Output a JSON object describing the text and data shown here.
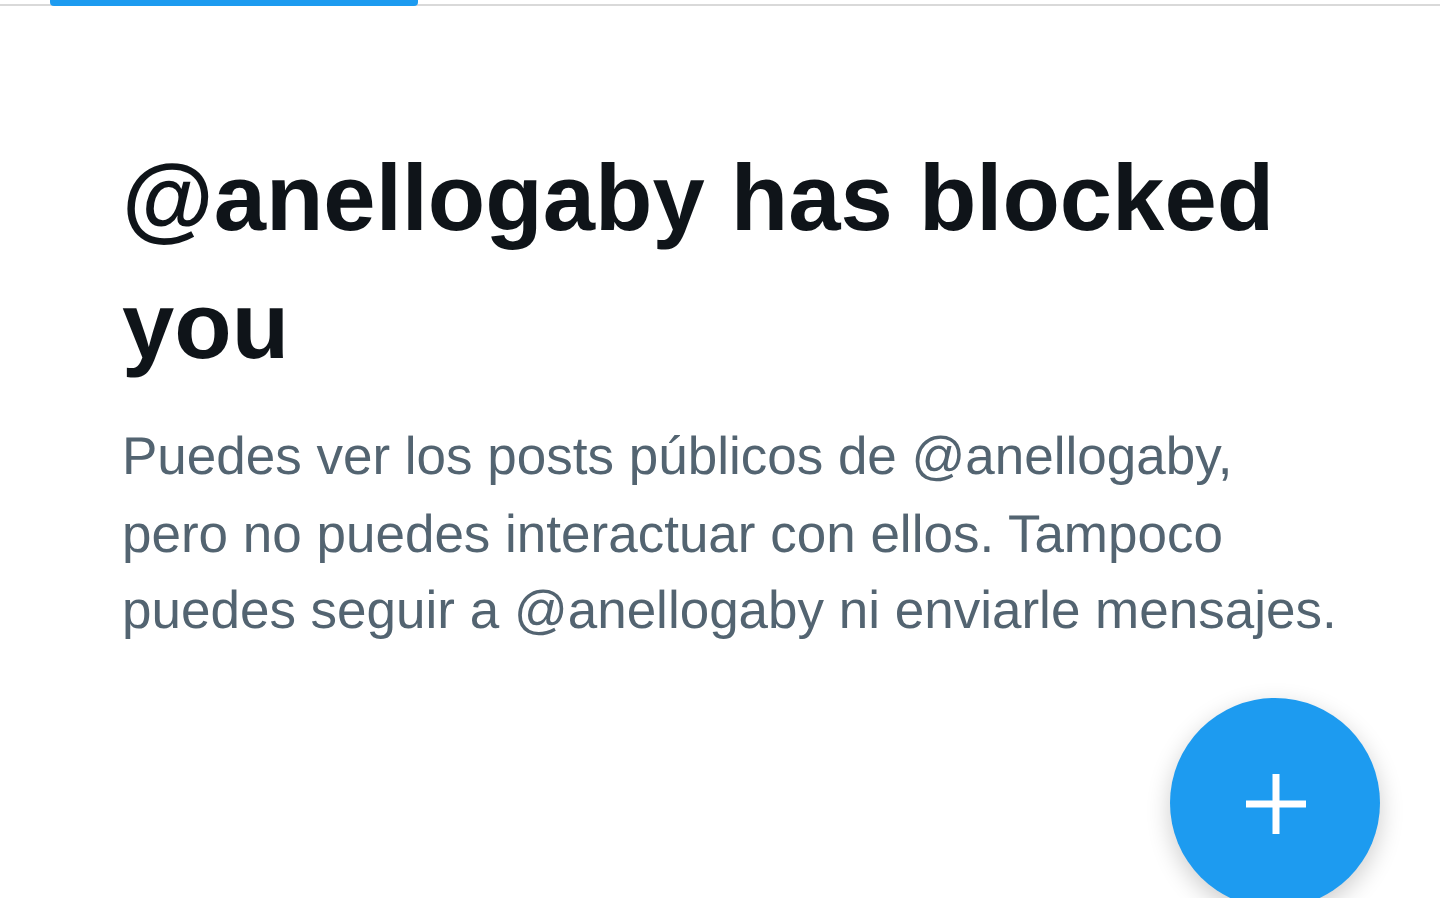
{
  "title": "@anellogaby has blocked you",
  "message": "Puedes ver los posts públicos de @anellogaby, pero no puedes interactuar con ellos. Tampoco puedes seguir a @anellogaby ni enviarle mensajes."
}
